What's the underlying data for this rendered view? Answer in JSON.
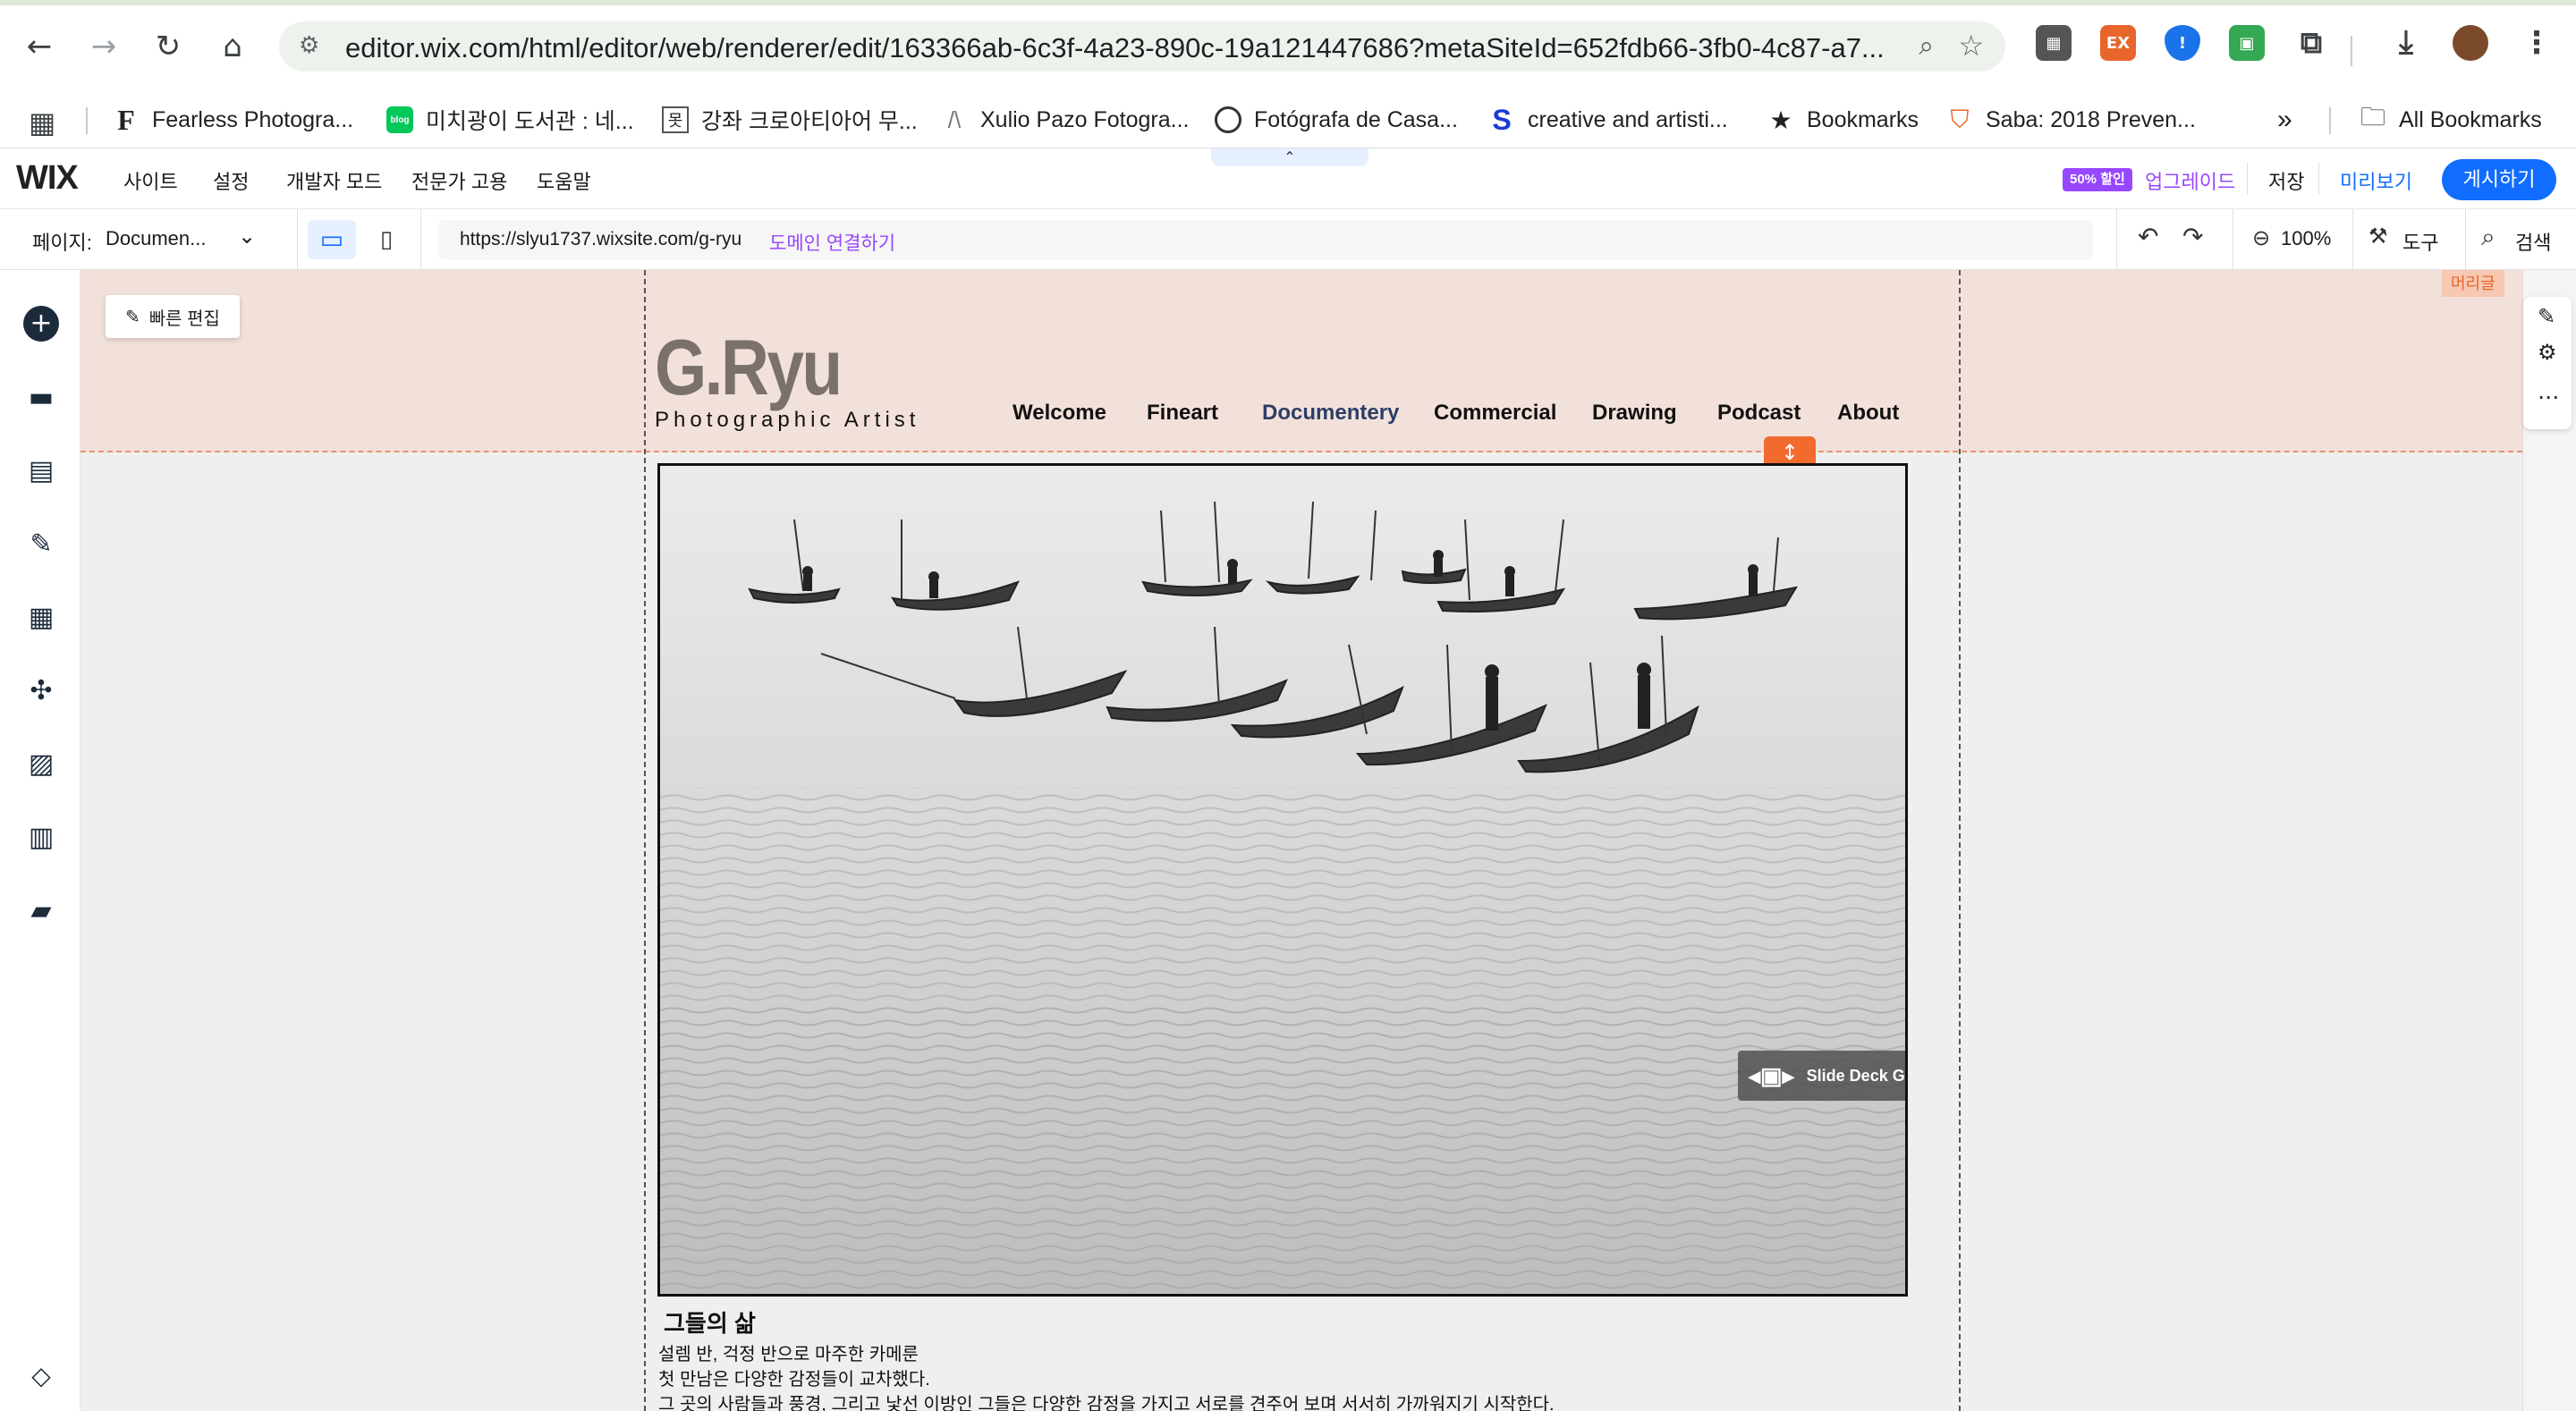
{
  "browser": {
    "url": "editor.wix.com/html/editor/web/renderer/edit/163366ab-6c3f-4a23-890c-19a121447686?metaSiteId=652fdb66-3fb0-4c87-a7...",
    "extensions": [
      "EX"
    ],
    "bookmarks": [
      {
        "label": "Fearless Photogra...",
        "icon": "F"
      },
      {
        "label": "미치광이 도서관 : 네...",
        "icon": "blog"
      },
      {
        "label": "강좌 크로아티아어 무...",
        "icon": "못"
      },
      {
        "label": "Xulio Pazo Fotogra...",
        "icon": "/\\"
      },
      {
        "label": "Fotógrafa de Casa...",
        "icon": "globe-icon"
      },
      {
        "label": "creative and artisti...",
        "icon": "S"
      },
      {
        "label": "Bookmarks",
        "icon": "star-icon"
      },
      {
        "label": "Saba: 2018 Preven...",
        "icon": "shield-icon"
      }
    ],
    "more": "»",
    "all_bookmarks": "All Bookmarks"
  },
  "wix": {
    "logo": "WIX",
    "menu": [
      "사이트",
      "설정",
      "개발자 모드",
      "전문가 고용",
      "도움말"
    ],
    "discount_badge": "50% 할인",
    "upgrade": "업그레이드",
    "save": "저장",
    "preview": "미리보기",
    "publish": "게시하기",
    "page_label": "페이지:",
    "page_value": "Documen...",
    "site_url": "https://slyu1737.wixsite.com/g-ryu",
    "connect_domain": "도메인 연결하기",
    "zoom": "100%",
    "tools": "도구",
    "search": "검색",
    "quick_edit": "빠른 편집",
    "header_tag": "머리글",
    "accent": "#116dff",
    "purple": "#9747ff"
  },
  "site": {
    "logo": "G.Ryu",
    "tagline": "Photographic Artist",
    "nav": [
      "Welcome",
      "Fineart",
      "Documentery",
      "Commercial",
      "Drawing",
      "Podcast",
      "About"
    ],
    "active_nav": "Documentery",
    "gallery_label": "Slide Deck Gallery",
    "caption_title": "그들의 삶",
    "caption_lines": [
      "설렘 반, 걱정 반으로 마주한 카메룬",
      "첫 만남은 다양한 감정들이 교차했다.",
      "그 곳의 사람들과 풍경, 그리고 낯선 이방인 그들은 다양한 감정을 가지고 서로를 견주어 보며 서서히 가까워지기 시작한다."
    ]
  }
}
